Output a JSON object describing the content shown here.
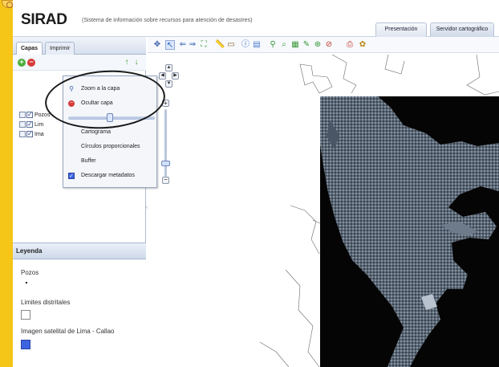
{
  "header": {
    "title": "SIRAD",
    "subtitle": "(Sistema de información sobre recursos para atención de desastres)",
    "tabs": [
      {
        "label": "Presentación"
      },
      {
        "label": "Servidor cartográfico"
      }
    ]
  },
  "left_panel": {
    "tabs": [
      {
        "label": "Capas",
        "active": true
      },
      {
        "label": "Imprimir",
        "active": false
      }
    ],
    "layers": [
      {
        "label": "Pozos",
        "checked": true
      },
      {
        "label": "Lim",
        "checked": true
      },
      {
        "label": "Ima",
        "checked": true
      }
    ]
  },
  "context_menu": {
    "items": [
      {
        "label": "Zoom a la capa",
        "icon": "magnifier-icon"
      },
      {
        "label": "Ocultar capa",
        "icon": "hide-red-icon"
      },
      {
        "label": "Cartograma",
        "icon": ""
      },
      {
        "label": "Círculos proporcionales",
        "icon": ""
      },
      {
        "label": "Buffer",
        "icon": ""
      },
      {
        "label": "Descargar metadatos",
        "icon": "checkbox-icon"
      }
    ]
  },
  "legend": {
    "header": "Leyenda",
    "entries": [
      {
        "title": "Pozos",
        "symbol": "point"
      },
      {
        "title": "Limites distritales",
        "symbol": "empty-square"
      },
      {
        "title": "Imagen satelital de Lima - Callao",
        "symbol": "blue-square"
      }
    ]
  },
  "colors": {
    "accent_yellow": "#f5c518",
    "legend_blue": "#3e63e0",
    "satellite_background": "#050505"
  }
}
